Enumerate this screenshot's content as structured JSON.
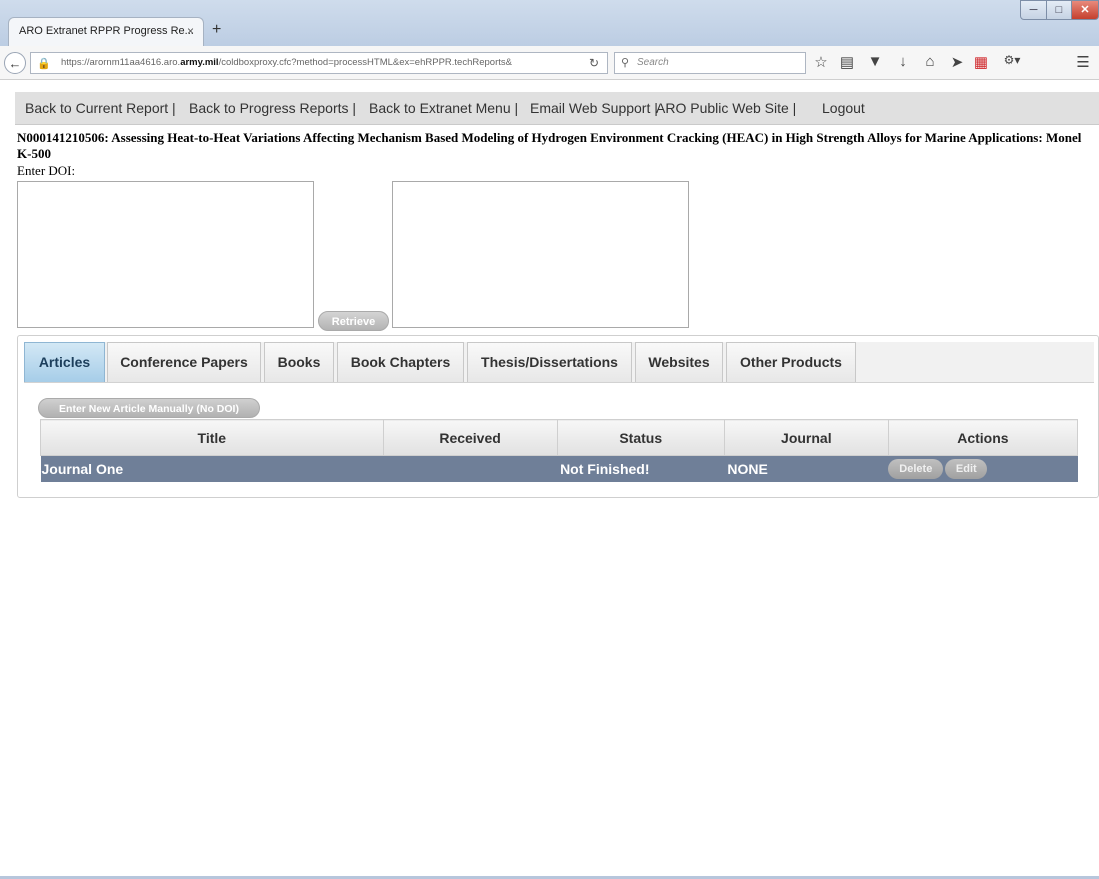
{
  "browser": {
    "tab_title": "ARO Extranet RPPR Progress Re...",
    "tab_close": "×",
    "new_tab": "+",
    "url_prefix": "https://arornm11aa4616.aro.",
    "url_domain": "army.mil",
    "url_suffix": "/coldboxproxy.cfc?method=processHTML&ex=ehRPPR.techReports&",
    "search_placeholder": "Search",
    "icons": [
      "back-icon",
      "lock-icon",
      "reload-icon",
      "search-icon",
      "bookmark-star-icon",
      "reading-list-icon",
      "pocket-icon",
      "download-icon",
      "home-icon",
      "send-icon",
      "addon-icon",
      "extensions-icon",
      "menu-icon"
    ]
  },
  "menu": {
    "current_report": "Back to Current Report |",
    "progress_reports": "Back to Progress Reports |",
    "extranet_menu": "Back to Extranet Menu |",
    "email_support": "Email Web Support |",
    "public_site": "ARO Public Web Site |",
    "logout": "Logout"
  },
  "report": {
    "title": "N000141210506: Assessing Heat-to-Heat Variations Affecting Mechanism Based Modeling of Hydrogen Environment Cracking (HEAC) in High Strength Alloys for Marine Applications: Monel K-500",
    "doi_label": "Enter DOI:"
  },
  "retrieve_label": "Retrieve",
  "tabs": [
    {
      "label": "Articles",
      "active": true
    },
    {
      "label": "Conference Papers"
    },
    {
      "label": "Books"
    },
    {
      "label": "Book Chapters"
    },
    {
      "label": "Thesis/Dissertations"
    },
    {
      "label": "Websites"
    },
    {
      "label": "Other Products"
    }
  ],
  "articles": {
    "enter_new_label": "Enter New Article Manually (No DOI)",
    "columns": [
      "Title",
      "Received",
      "Status",
      "Journal",
      "Actions"
    ],
    "rows": [
      {
        "title": "Journal One",
        "received": "",
        "status": "Not Finished!",
        "journal": "NONE",
        "delete_label": "Delete",
        "edit_label": "Edit"
      }
    ]
  },
  "colors": {
    "active_tab": "#a6cde8",
    "row_bg": "#6f7f98",
    "menubar_bg": "#e0e0e0"
  }
}
